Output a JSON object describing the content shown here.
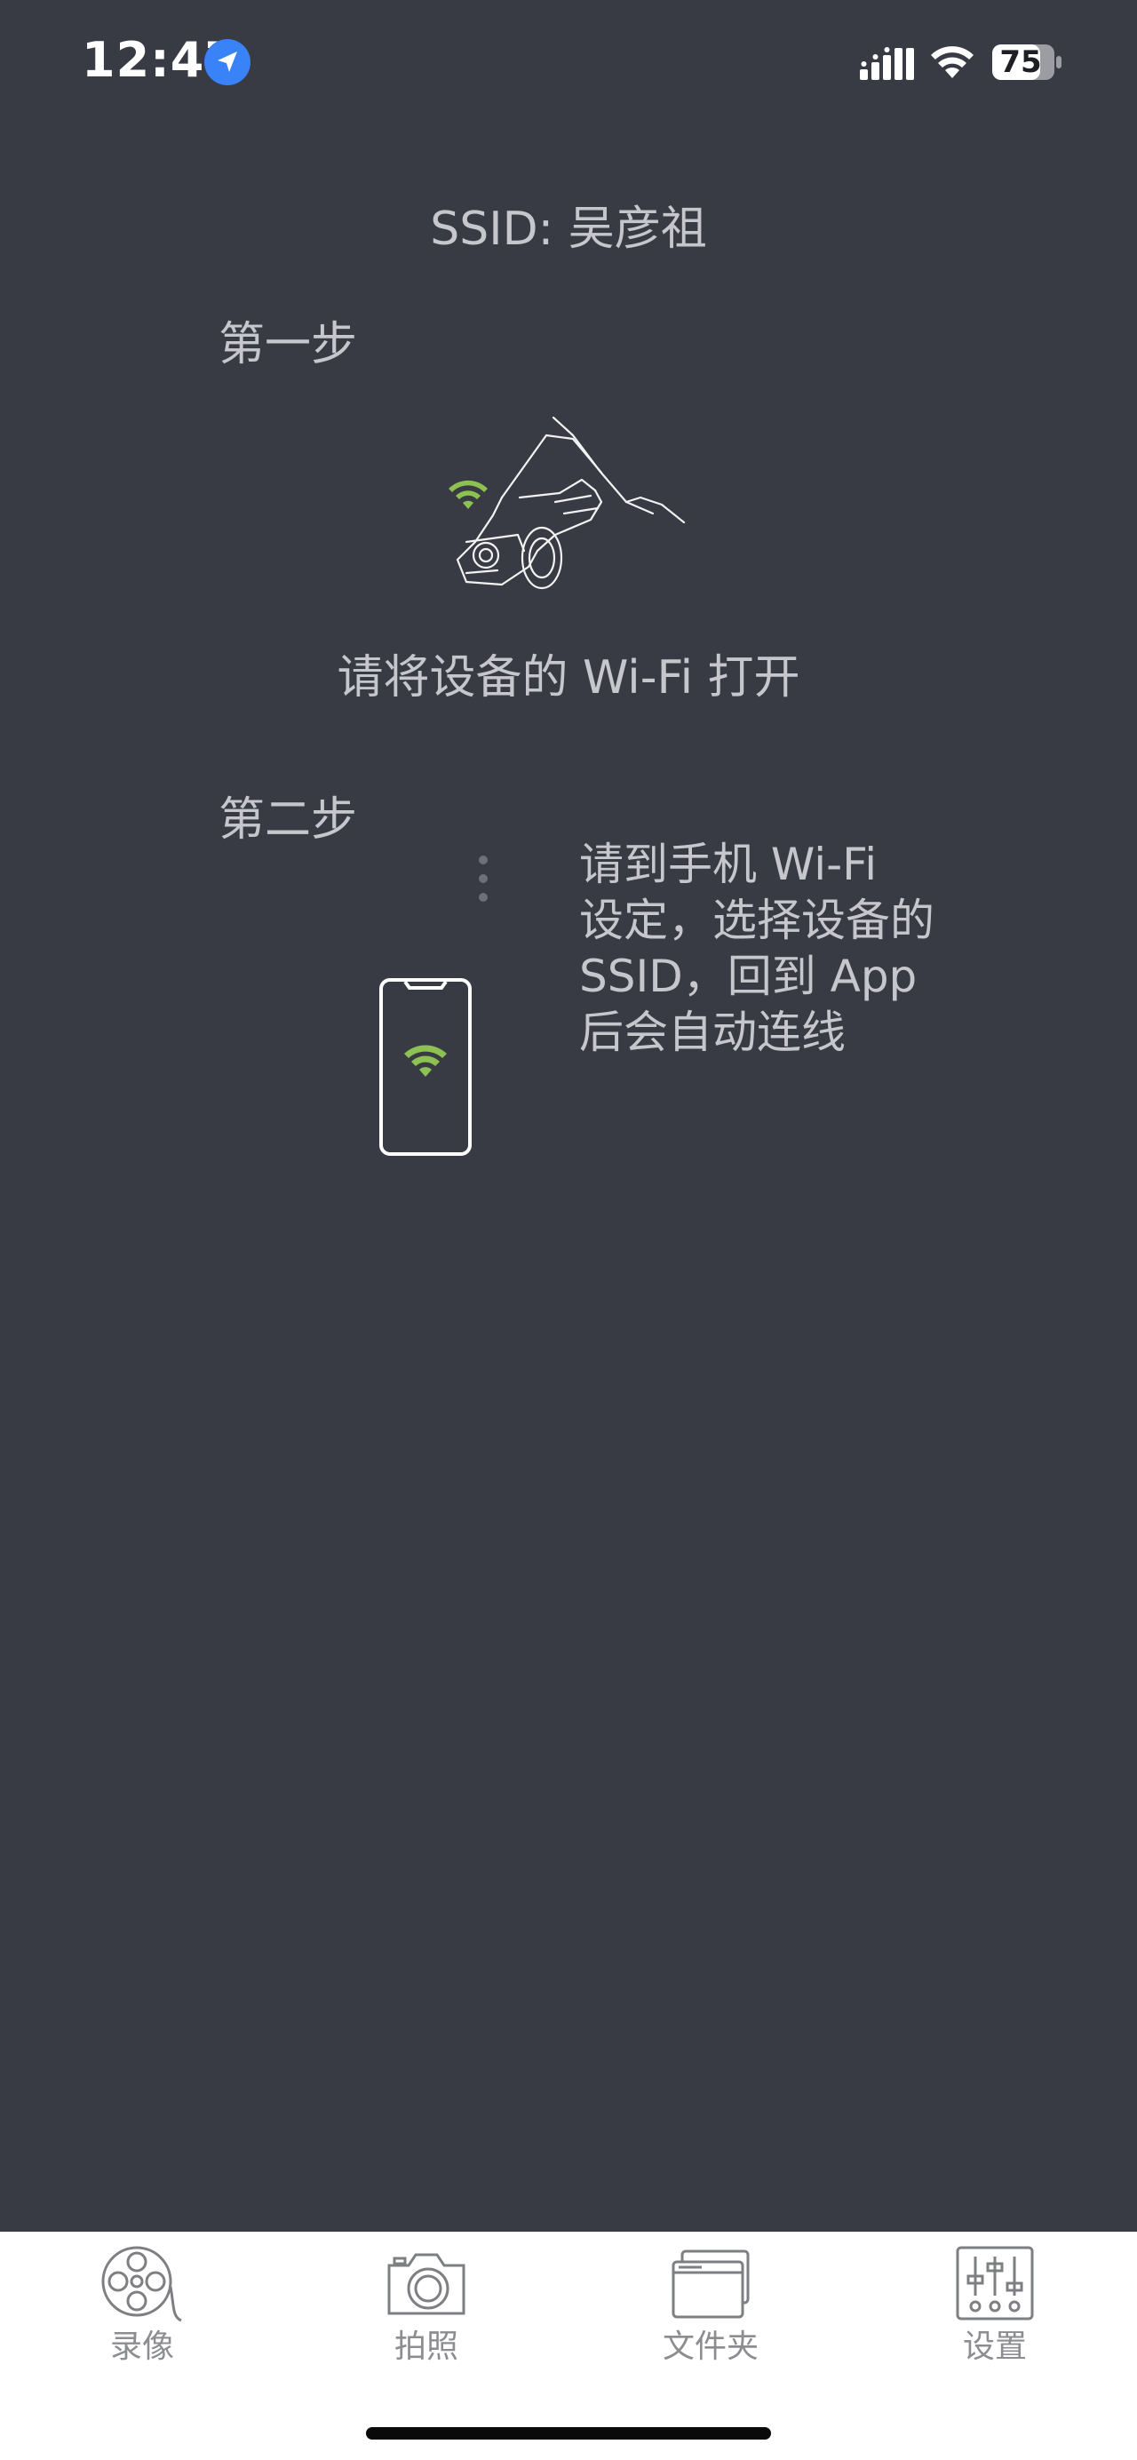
{
  "status_bar": {
    "time": "12:47",
    "battery_level": "75",
    "icons": [
      "location-icon",
      "signal-icon",
      "wifi-icon",
      "battery-icon"
    ]
  },
  "main": {
    "ssid_label": "SSID: 吴彦祖",
    "step1": {
      "title": "第一步",
      "instruction": "请将设备的 Wi-Fi 打开"
    },
    "step2": {
      "title": "第二步",
      "instruction": "请到手机 Wi-Fi 设定，选择设备的 SSID，回到 App 后会自动连线"
    }
  },
  "tab_bar": {
    "items": [
      {
        "label": "录像",
        "icon": "film-reel-icon"
      },
      {
        "label": "拍照",
        "icon": "camera-icon"
      },
      {
        "label": "文件夹",
        "icon": "folder-icon"
      },
      {
        "label": "设置",
        "icon": "sliders-icon"
      }
    ]
  },
  "colors": {
    "background": "#393b44",
    "wifi_accent": "#8dc152",
    "tab_bar": "#ffffff",
    "tab_label": "#8c8d90"
  }
}
